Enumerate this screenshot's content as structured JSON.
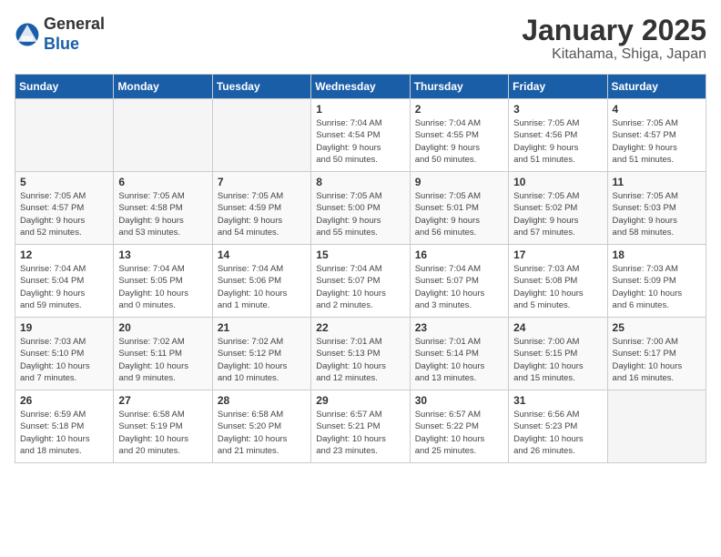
{
  "header": {
    "logo": {
      "general": "General",
      "blue": "Blue"
    },
    "title": "January 2025",
    "subtitle": "Kitahama, Shiga, Japan"
  },
  "weekdays": [
    "Sunday",
    "Monday",
    "Tuesday",
    "Wednesday",
    "Thursday",
    "Friday",
    "Saturday"
  ],
  "weeks": [
    [
      {
        "day": "",
        "info": ""
      },
      {
        "day": "",
        "info": ""
      },
      {
        "day": "",
        "info": ""
      },
      {
        "day": "1",
        "info": "Sunrise: 7:04 AM\nSunset: 4:54 PM\nDaylight: 9 hours\nand 50 minutes."
      },
      {
        "day": "2",
        "info": "Sunrise: 7:04 AM\nSunset: 4:55 PM\nDaylight: 9 hours\nand 50 minutes."
      },
      {
        "day": "3",
        "info": "Sunrise: 7:05 AM\nSunset: 4:56 PM\nDaylight: 9 hours\nand 51 minutes."
      },
      {
        "day": "4",
        "info": "Sunrise: 7:05 AM\nSunset: 4:57 PM\nDaylight: 9 hours\nand 51 minutes."
      }
    ],
    [
      {
        "day": "5",
        "info": "Sunrise: 7:05 AM\nSunset: 4:57 PM\nDaylight: 9 hours\nand 52 minutes."
      },
      {
        "day": "6",
        "info": "Sunrise: 7:05 AM\nSunset: 4:58 PM\nDaylight: 9 hours\nand 53 minutes."
      },
      {
        "day": "7",
        "info": "Sunrise: 7:05 AM\nSunset: 4:59 PM\nDaylight: 9 hours\nand 54 minutes."
      },
      {
        "day": "8",
        "info": "Sunrise: 7:05 AM\nSunset: 5:00 PM\nDaylight: 9 hours\nand 55 minutes."
      },
      {
        "day": "9",
        "info": "Sunrise: 7:05 AM\nSunset: 5:01 PM\nDaylight: 9 hours\nand 56 minutes."
      },
      {
        "day": "10",
        "info": "Sunrise: 7:05 AM\nSunset: 5:02 PM\nDaylight: 9 hours\nand 57 minutes."
      },
      {
        "day": "11",
        "info": "Sunrise: 7:05 AM\nSunset: 5:03 PM\nDaylight: 9 hours\nand 58 minutes."
      }
    ],
    [
      {
        "day": "12",
        "info": "Sunrise: 7:04 AM\nSunset: 5:04 PM\nDaylight: 9 hours\nand 59 minutes."
      },
      {
        "day": "13",
        "info": "Sunrise: 7:04 AM\nSunset: 5:05 PM\nDaylight: 10 hours\nand 0 minutes."
      },
      {
        "day": "14",
        "info": "Sunrise: 7:04 AM\nSunset: 5:06 PM\nDaylight: 10 hours\nand 1 minute."
      },
      {
        "day": "15",
        "info": "Sunrise: 7:04 AM\nSunset: 5:07 PM\nDaylight: 10 hours\nand 2 minutes."
      },
      {
        "day": "16",
        "info": "Sunrise: 7:04 AM\nSunset: 5:07 PM\nDaylight: 10 hours\nand 3 minutes."
      },
      {
        "day": "17",
        "info": "Sunrise: 7:03 AM\nSunset: 5:08 PM\nDaylight: 10 hours\nand 5 minutes."
      },
      {
        "day": "18",
        "info": "Sunrise: 7:03 AM\nSunset: 5:09 PM\nDaylight: 10 hours\nand 6 minutes."
      }
    ],
    [
      {
        "day": "19",
        "info": "Sunrise: 7:03 AM\nSunset: 5:10 PM\nDaylight: 10 hours\nand 7 minutes."
      },
      {
        "day": "20",
        "info": "Sunrise: 7:02 AM\nSunset: 5:11 PM\nDaylight: 10 hours\nand 9 minutes."
      },
      {
        "day": "21",
        "info": "Sunrise: 7:02 AM\nSunset: 5:12 PM\nDaylight: 10 hours\nand 10 minutes."
      },
      {
        "day": "22",
        "info": "Sunrise: 7:01 AM\nSunset: 5:13 PM\nDaylight: 10 hours\nand 12 minutes."
      },
      {
        "day": "23",
        "info": "Sunrise: 7:01 AM\nSunset: 5:14 PM\nDaylight: 10 hours\nand 13 minutes."
      },
      {
        "day": "24",
        "info": "Sunrise: 7:00 AM\nSunset: 5:15 PM\nDaylight: 10 hours\nand 15 minutes."
      },
      {
        "day": "25",
        "info": "Sunrise: 7:00 AM\nSunset: 5:17 PM\nDaylight: 10 hours\nand 16 minutes."
      }
    ],
    [
      {
        "day": "26",
        "info": "Sunrise: 6:59 AM\nSunset: 5:18 PM\nDaylight: 10 hours\nand 18 minutes."
      },
      {
        "day": "27",
        "info": "Sunrise: 6:58 AM\nSunset: 5:19 PM\nDaylight: 10 hours\nand 20 minutes."
      },
      {
        "day": "28",
        "info": "Sunrise: 6:58 AM\nSunset: 5:20 PM\nDaylight: 10 hours\nand 21 minutes."
      },
      {
        "day": "29",
        "info": "Sunrise: 6:57 AM\nSunset: 5:21 PM\nDaylight: 10 hours\nand 23 minutes."
      },
      {
        "day": "30",
        "info": "Sunrise: 6:57 AM\nSunset: 5:22 PM\nDaylight: 10 hours\nand 25 minutes."
      },
      {
        "day": "31",
        "info": "Sunrise: 6:56 AM\nSunset: 5:23 PM\nDaylight: 10 hours\nand 26 minutes."
      },
      {
        "day": "",
        "info": ""
      }
    ]
  ]
}
